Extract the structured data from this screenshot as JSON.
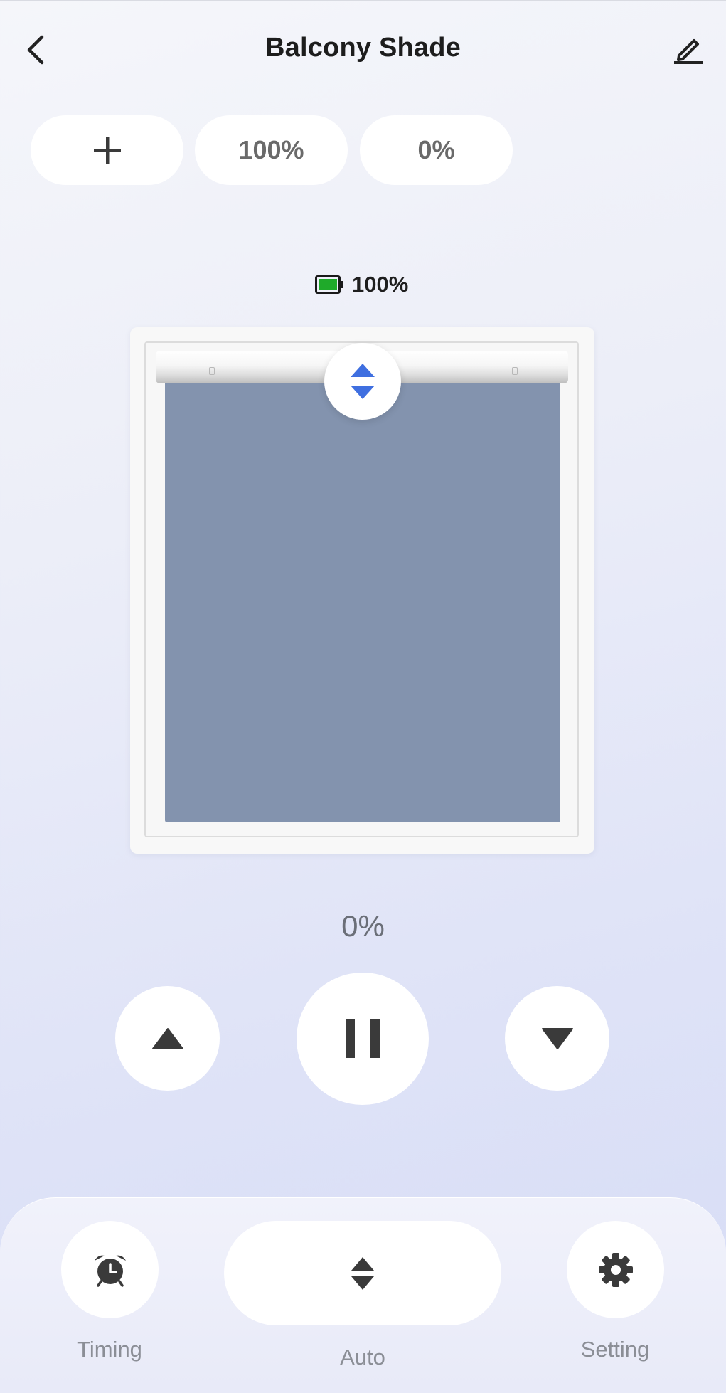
{
  "header": {
    "title": "Balcony Shade",
    "back_icon": "chevron-left-icon",
    "edit_icon": "pencil-icon"
  },
  "quick_actions": [
    {
      "label": "+",
      "icon": "plus-icon"
    },
    {
      "label": "100%"
    },
    {
      "label": "0%"
    }
  ],
  "battery": {
    "level_text": "100%",
    "level_fraction": 1.0,
    "color": "#1faa2a"
  },
  "shade": {
    "position_text": "0%",
    "fabric_color": "#8393ae",
    "accent_color": "#3f6fe0",
    "handle_icon": "up-down-arrows-icon"
  },
  "controls": {
    "open_icon": "triangle-up-icon",
    "stop_icon": "pause-icon",
    "close_icon": "triangle-down-icon"
  },
  "bottom_nav": [
    {
      "label": "Timing",
      "icon": "alarm-clock-icon"
    },
    {
      "label": "Auto",
      "icon": "up-down-arrows-icon"
    },
    {
      "label": "Setting",
      "icon": "gear-icon"
    }
  ]
}
